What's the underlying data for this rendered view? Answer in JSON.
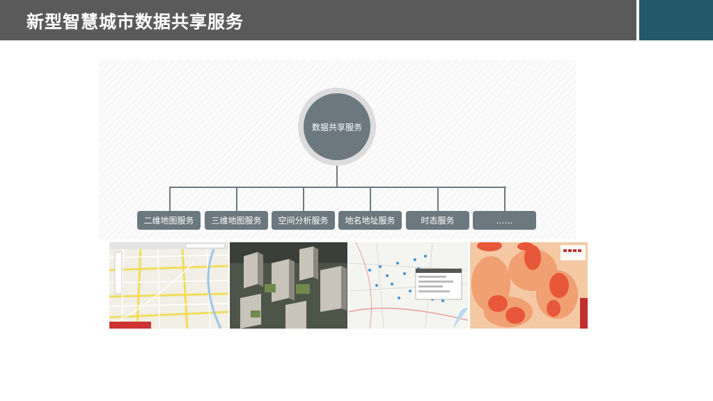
{
  "header": {
    "title": "新型智慧城市数据共享服务"
  },
  "hub": {
    "label": "数据共享服务"
  },
  "services": [
    {
      "label": "二维地图服务"
    },
    {
      "label": "三维地图服务"
    },
    {
      "label": "空间分析服务"
    },
    {
      "label": "地名地址服务"
    },
    {
      "label": "时态服务"
    },
    {
      "label": "……"
    }
  ],
  "colors": {
    "header": "#5a5a5a",
    "accent": "#23596a",
    "node": "#6b7880"
  },
  "thumbnails": [
    {
      "name": "2d-map-screenshot"
    },
    {
      "name": "3d-city-screenshot"
    },
    {
      "name": "spatial-analysis-screenshot"
    },
    {
      "name": "heatmap-screenshot"
    }
  ]
}
